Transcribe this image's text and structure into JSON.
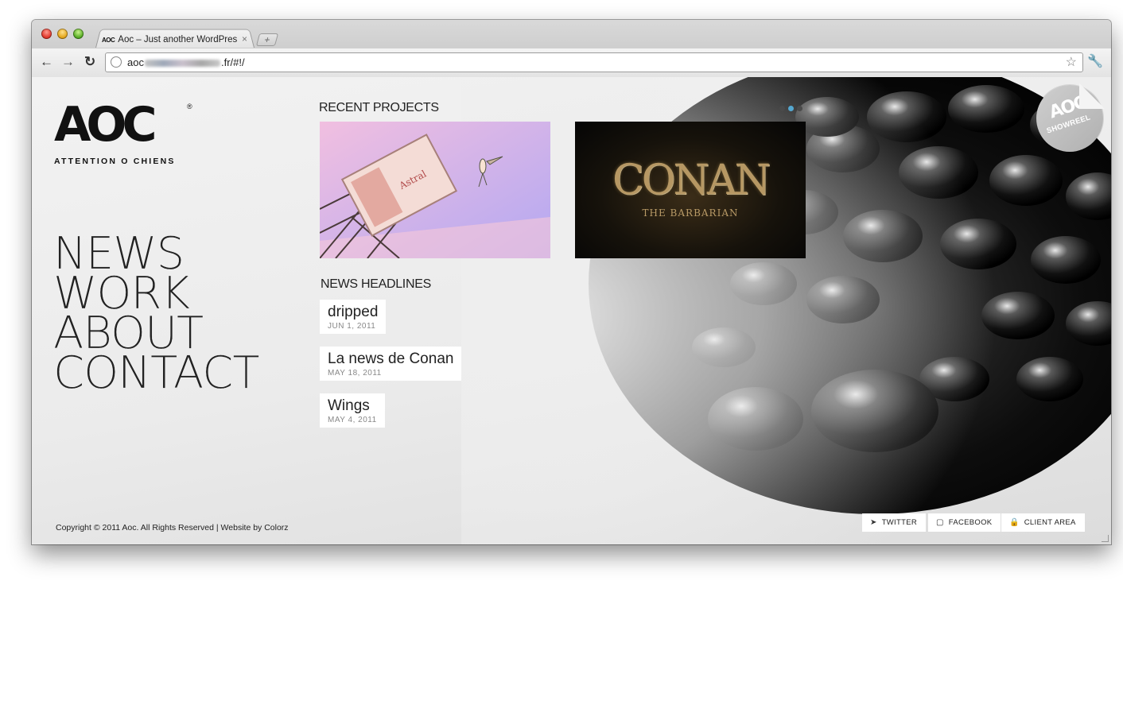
{
  "browser": {
    "tab_favicon": "AOC",
    "tab_title": "Aoc – Just another WordPress site",
    "tab_close": "×",
    "new_tab": "+",
    "url_prefix": "aoc",
    "url_suffix": ".fr/#!/",
    "back_icon": "back-arrow-icon",
    "forward_icon": "forward-arrow-icon",
    "reload_icon": "reload-icon",
    "star_icon": "bookmark-star-icon",
    "wrench_icon": "wrench-menu-icon"
  },
  "logo": {
    "mark": "AOC",
    "registered": "®",
    "tagline": "ATTENTION O CHIENS"
  },
  "nav": [
    "NEWS",
    "WORK",
    "ABOUT",
    "CONTACT"
  ],
  "recent": {
    "title": "RECENT PROJECTS",
    "conan_title": "CONAN",
    "conan_subtitle": "THE BARBARIAN"
  },
  "news": {
    "title": "NEWS HEADLINES",
    "items": [
      {
        "title": "dripped",
        "date": "JUN 1, 2011"
      },
      {
        "title": "La news de Conan",
        "date": "MAY 18, 2011"
      },
      {
        "title": "Wings",
        "date": "MAY 4, 2011"
      }
    ]
  },
  "showreel": {
    "mark": "AOC",
    "label": "SHOWREEL"
  },
  "footer": {
    "copyright": "Copyright © 2011 Aoc. All Rights Reserved | Website by Colorz",
    "twitter": "TWITTER",
    "facebook": "FACEBOOK",
    "client_area": "CLIENT AREA"
  },
  "colors": {
    "accent_dot": "#55a8d0",
    "text": "#222222"
  }
}
